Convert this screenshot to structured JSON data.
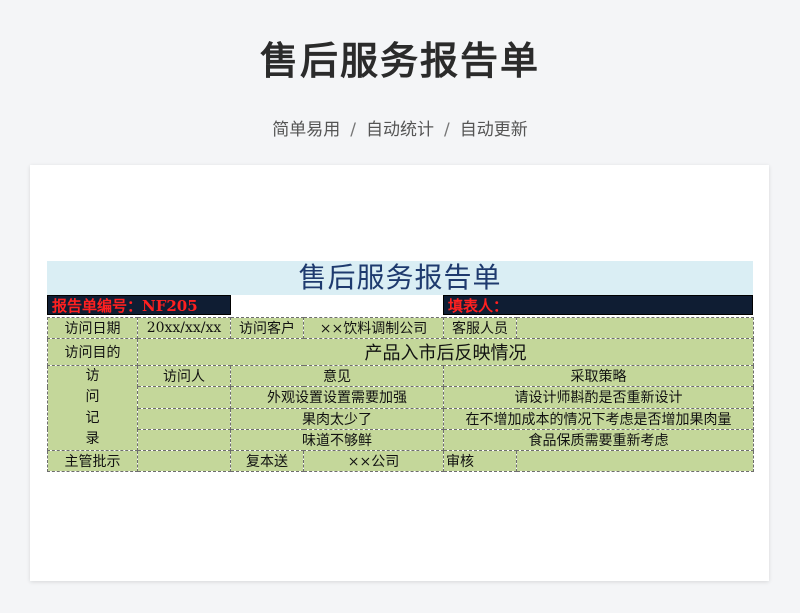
{
  "page": {
    "title": "售后服务报告单",
    "subtitle_parts": [
      "简单易用",
      "自动统计",
      "自动更新"
    ]
  },
  "sheet": {
    "title": "售后服务报告单",
    "report_no_label": "报告单编号：NF205",
    "filler_label": "填表人：",
    "visit_date_label": "访问日期",
    "visit_date_value": "20xx/xx/xx",
    "visit_customer_label": "访问客户",
    "visit_customer_value": "××饮料调制公司",
    "service_person_label": "客服人员",
    "service_person_value": "",
    "visit_goal_label": "访问目的",
    "visit_goal_value": "产品入市后反映情况",
    "record_label_chars": [
      "访",
      "问",
      "记",
      "录"
    ],
    "record_headers": [
      "访问人",
      "意见",
      "采取策略"
    ],
    "records": [
      {
        "visitor": "",
        "opinion": "外观设置设置需要加强",
        "strategy": "请设计师斟酌是否重新设计"
      },
      {
        "visitor": "",
        "opinion": "果肉太少了",
        "strategy": "在不增加成本的情况下考虑是否增加果肉量"
      },
      {
        "visitor": "",
        "opinion": "味道不够鲜",
        "strategy": "食品保质需要重新考虑"
      }
    ],
    "approval_label": "主管批示",
    "approval_value": "",
    "copy_label": "复本送",
    "copy_value": "××公司",
    "review_label": "审核",
    "review_value": ""
  }
}
